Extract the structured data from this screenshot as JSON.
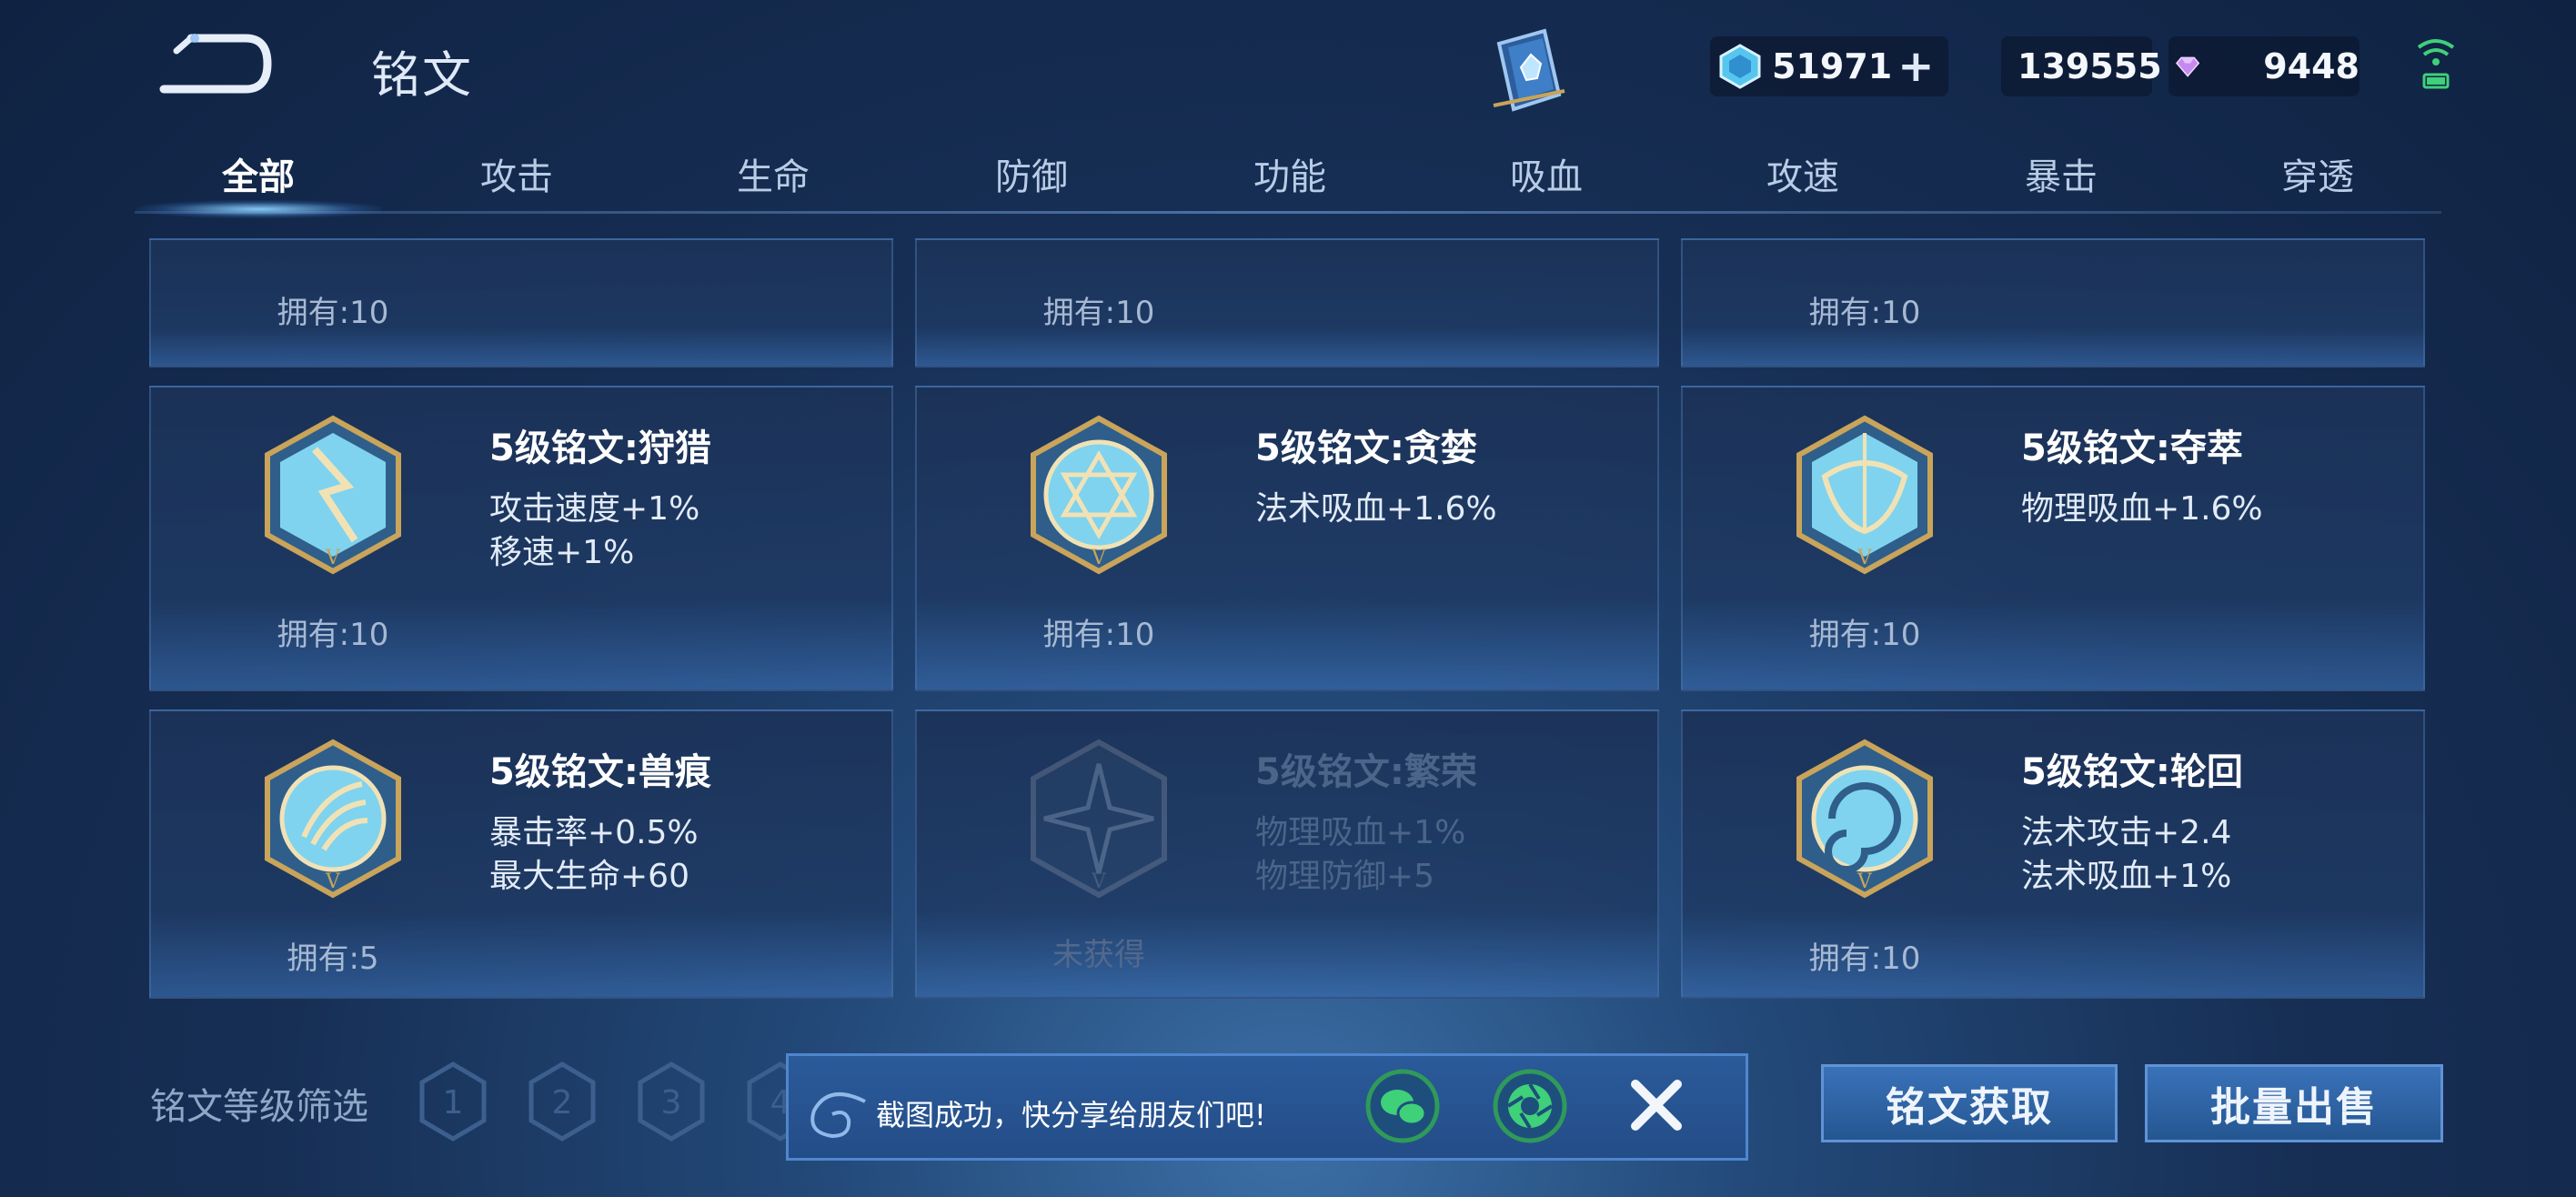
{
  "header": {
    "title": "铭文",
    "currencies": [
      {
        "name": "coupon-icon",
        "value": "51971",
        "plus": "+"
      },
      {
        "name": "gold-coin-icon",
        "value": "139555"
      },
      {
        "name": "diamond-icon",
        "value": "9448"
      }
    ]
  },
  "tabs": [
    "全部",
    "攻击",
    "生命",
    "防御",
    "功能",
    "吸血",
    "攻速",
    "暴击",
    "穿透"
  ],
  "active_tab": "全部",
  "cards_partial": [
    {
      "owned": "拥有:10"
    },
    {
      "owned": "拥有:10"
    },
    {
      "owned": "拥有:10"
    }
  ],
  "cards": [
    {
      "name": "5级铭文:狩猎",
      "attr1": "攻击速度+1%",
      "attr2": "移速+1%",
      "owned": "拥有:10",
      "icon": "hunt-rune-icon"
    },
    {
      "name": "5级铭文:贪婪",
      "attr1": "法术吸血+1.6%",
      "attr2": "",
      "owned": "拥有:10",
      "icon": "greed-rune-icon"
    },
    {
      "name": "5级铭文:夺萃",
      "attr1": "物理吸血+1.6%",
      "attr2": "",
      "owned": "拥有:10",
      "icon": "plunder-rune-icon"
    },
    {
      "name": "5级铭文:兽痕",
      "attr1": "暴击率+0.5%",
      "attr2": "最大生命+60",
      "owned": "拥有:5",
      "icon": "beast-mark-rune-icon"
    },
    {
      "name": "5级铭文:繁荣",
      "attr1": "物理吸血+1%",
      "attr2": "物理防御+5",
      "owned": "未获得",
      "icon": "prosperity-rune-icon",
      "locked": true
    },
    {
      "name": "5级铭文:轮回",
      "attr1": "法术攻击+2.4",
      "attr2": "法术吸血+1%",
      "owned": "拥有:10",
      "icon": "cycle-rune-icon"
    }
  ],
  "filter": {
    "label": "铭文等级筛选",
    "levels": [
      "1",
      "2",
      "3",
      "4"
    ]
  },
  "share_toast": {
    "text": "截图成功，快分享给朋友们吧!"
  },
  "buttons": {
    "obtain": "铭文获取",
    "batch_sell": "批量出售"
  },
  "colors": {
    "accent": "#4f86cf",
    "gold_frame": "#c9a45a",
    "rune_cyan": "#7fd3ee",
    "wechat_green": "#2f9a5a"
  }
}
